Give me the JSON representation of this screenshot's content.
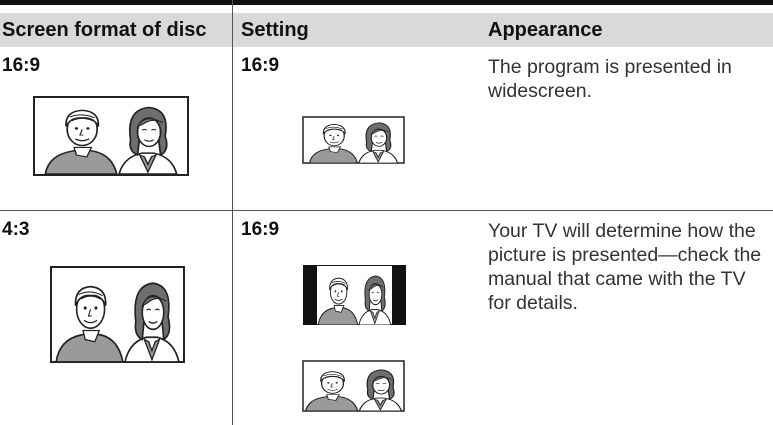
{
  "table": {
    "headers": {
      "format": "Screen format of disc",
      "setting": "Setting",
      "appearance": "Appearance"
    },
    "rows": [
      {
        "format": "16:9",
        "setting": "16:9",
        "appearance": "The program is presented in widescreen.",
        "disc_picture": "widescreen-couple-image",
        "setting_pictures": [
          "widescreen-couple-image"
        ]
      },
      {
        "format": "4:3",
        "setting": "16:9",
        "appearance": "Your TV will determine how the picture is presented—check the manual that came with the TV for details.",
        "disc_picture": "standard-couple-image",
        "setting_pictures": [
          "pillarbox-couple-image",
          "stretched-couple-image"
        ]
      }
    ]
  }
}
